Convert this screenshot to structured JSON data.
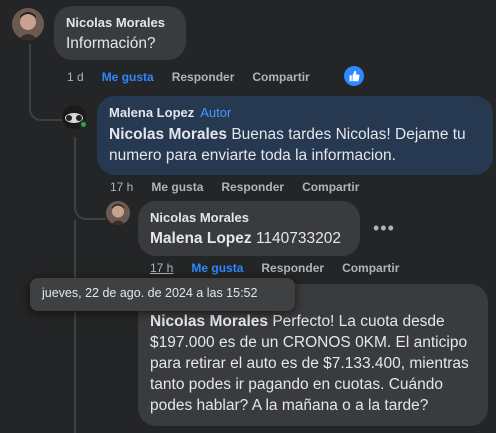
{
  "comments": {
    "c1": {
      "author": "Nicolas Morales",
      "text": "Información?",
      "time": "1 d",
      "like": "Me gusta",
      "reply": "Responder",
      "share": "Compartir"
    },
    "c2": {
      "author": "Malena Lopez",
      "badge": "Autor",
      "mention": "Nicolas Morales",
      "text": " Buenas tardes Nicolas! Dejame tu numero para enviarte toda la informacion.",
      "time": "17 h",
      "like": "Me gusta",
      "reply": "Responder",
      "share": "Compartir"
    },
    "c3": {
      "author": "Nicolas Morales",
      "mention": "Malena Lopez",
      "text": " 1140733202",
      "time": "17 h",
      "like": "Me gusta",
      "reply": "Responder",
      "share": "Compartir"
    },
    "c4": {
      "mention": "Nicolas Morales",
      "text": " Perfecto! La cuota desde $197.000 es de un CRONOS 0KM. El anticipo para retirar el auto es de $7.133.400, mientras tanto podes ir pagando en cuotas. Cuándo podes hablar? A la mañana o a la tarde?"
    }
  },
  "tooltip": "jueves, 22 de ago. de 2024 a las 15:52",
  "colors": {
    "background": "#242526",
    "bubble": "#3a3b3c",
    "author_bubble": "#263951",
    "link_blue": "#2d88ff",
    "muted": "#b0b3b8"
  }
}
